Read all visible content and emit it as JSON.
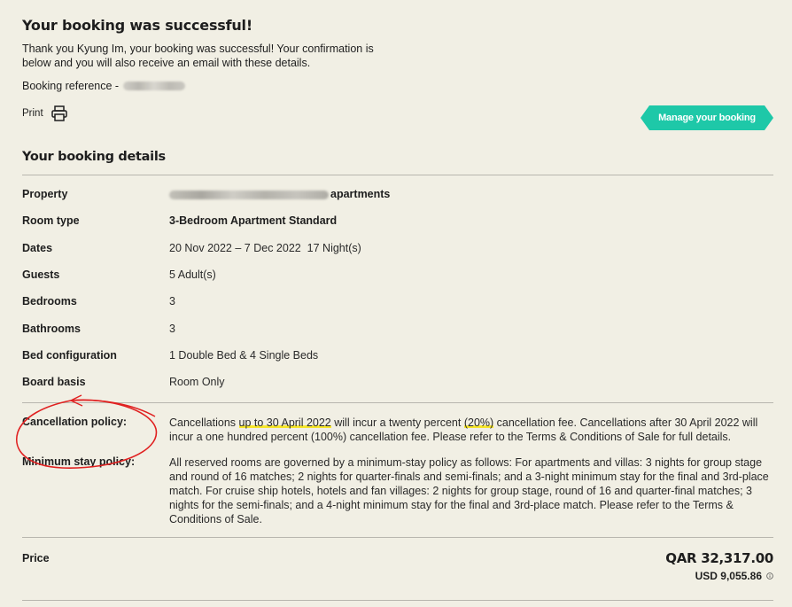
{
  "header": {
    "title": "Your booking was successful!",
    "thanks": "Thank you Kyung Im, your booking was successful! Your confirmation is below and you will also receive an email with these details.",
    "ref_label": "Booking reference -",
    "print_label": "Print",
    "manage_label": "Manage your booking"
  },
  "details": {
    "title": "Your booking details",
    "property_label": "Property",
    "property_value_visible": "apartments",
    "room_type_label": "Room type",
    "room_type_value": "3-Bedroom Apartment Standard",
    "dates_label": "Dates",
    "dates_value": "20 Nov 2022 – 7 Dec 2022  17 Night(s)",
    "guests_label": "Guests",
    "guests_value": "5 Adult(s)",
    "bedrooms_label": "Bedrooms",
    "bedrooms_value": "3",
    "bathrooms_label": "Bathrooms",
    "bathrooms_value": "3",
    "bed_config_label": "Bed configuration",
    "bed_config_value": "1 Double Bed & 4 Single Beds",
    "board_label": "Board basis",
    "board_value": "Room Only"
  },
  "cancellation": {
    "label": "Cancellation policy:",
    "text_1": "Cancellations ",
    "hl_1": "up to 30 April 2022",
    "text_2": " will incur a twenty percent ",
    "hl_2": "(20%)",
    "text_3": " cancellation fee. Cancellations after 30 April 2022 will incur a one hundred percent (100%) cancellation fee. Please refer to the Terms & Conditions of Sale for full details."
  },
  "min_stay": {
    "label": "Minimum stay policy:",
    "text": "All reserved rooms are governed by a minimum-stay policy as follows: For apartments and villas: 3 nights for group stage and round of 16 matches; 2 nights for quarter-finals and semi-finals; and a 3-night minimum stay for the final and 3rd-place match. For cruise ship hotels, hotels and fan villages: 2 nights for group stage, round of 16 and quarter-final matches; 3 nights for the semi-finals; and a 4-night minimum stay for the final and 3rd-place match. Please refer to the Terms & Conditions of Sale."
  },
  "price": {
    "label": "Price",
    "qar": "QAR 32,317.00",
    "usd": "USD 9,055.86"
  },
  "colors": {
    "background": "#f1efe4",
    "accent": "#1ec8a8",
    "highlight": "#f7e62a",
    "annotation": "#e02020"
  }
}
